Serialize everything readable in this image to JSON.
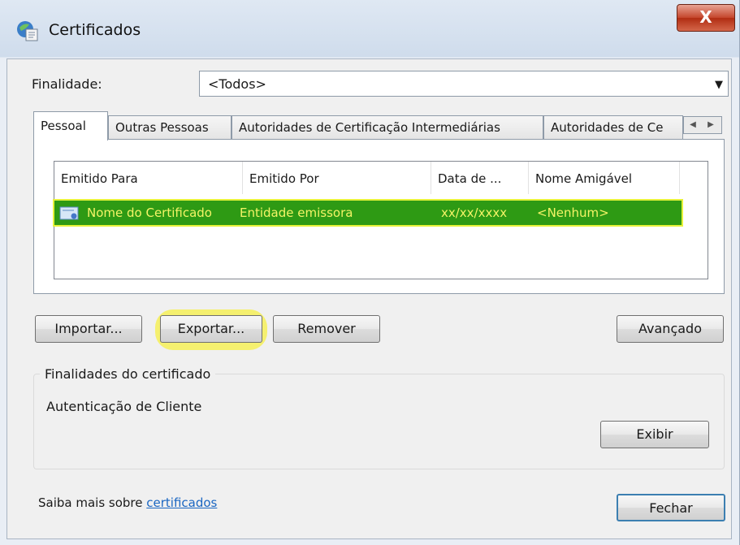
{
  "window": {
    "title": "Certificados",
    "close_label": "X"
  },
  "purpose": {
    "label": "Finalidade:",
    "selected": "<Todos>"
  },
  "tabs": [
    {
      "label": "Pessoal",
      "active": true
    },
    {
      "label": "Outras Pessoas",
      "active": false
    },
    {
      "label": "Autoridades de Certificação Intermediárias",
      "active": false
    },
    {
      "label": "Autoridades de Ce",
      "active": false
    }
  ],
  "list": {
    "columns": [
      "Emitido Para",
      "Emitido Por",
      "Data de ...",
      "Nome Amigável"
    ],
    "rows": [
      {
        "issued_to": "Nome do Certificado",
        "issued_by": "Entidade emissora",
        "date": "xx/xx/xxxx",
        "friendly_name": "<Nenhum>"
      }
    ]
  },
  "buttons": {
    "import": "Importar...",
    "export": "Exportar...",
    "remove": "Remover",
    "advanced": "Avançado",
    "view": "Exibir",
    "close": "Fechar"
  },
  "purposes_group": {
    "title": "Finalidades do certificado",
    "text": "Autenticação de Cliente"
  },
  "footer": {
    "prefix": "Saiba mais sobre ",
    "link": "certificados"
  },
  "icons": [
    "certificate-manager-icon",
    "certificate-icon",
    "dropdown-arrow-icon",
    "tab-scroll-left-icon",
    "tab-scroll-right-icon",
    "close-icon"
  ],
  "colors": {
    "highlight_row": "#2e9a14",
    "highlight_text": "#f4f466",
    "export_highlight": "#f5f060",
    "link": "#1a66c2"
  }
}
